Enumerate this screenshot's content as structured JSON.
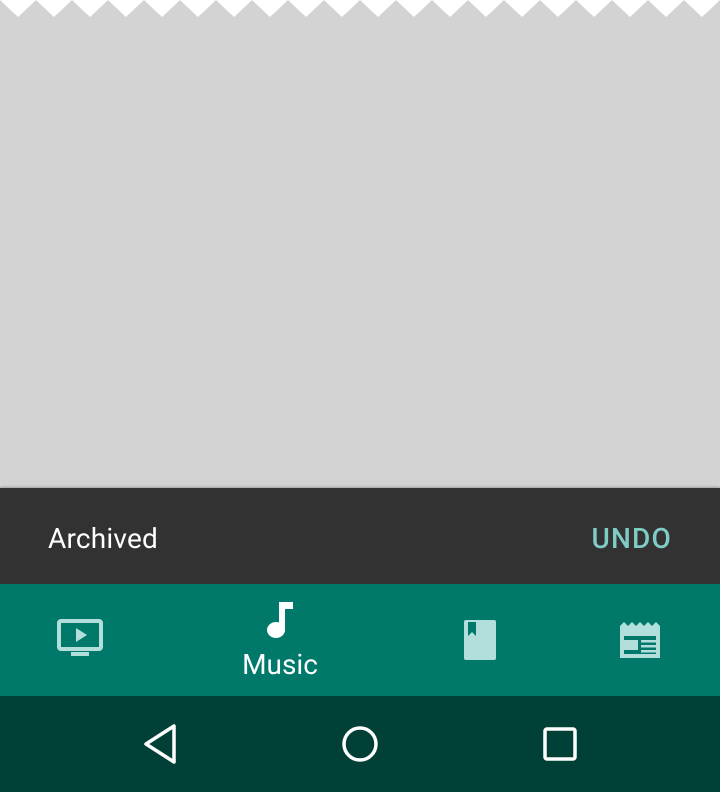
{
  "snackbar": {
    "message": "Archived",
    "action_label": "UNDO",
    "background": "#323232",
    "action_color": "#80cbc4"
  },
  "bottom_nav": {
    "background": "#00796b",
    "items": [
      {
        "icon": "tv-play-icon",
        "label": "",
        "active": false
      },
      {
        "icon": "music-note-icon",
        "label": "Music",
        "active": true
      },
      {
        "icon": "book-icon",
        "label": "",
        "active": false
      },
      {
        "icon": "newspaper-icon",
        "label": "",
        "active": false
      }
    ]
  },
  "system_nav": {
    "background": "#004036",
    "buttons": [
      "back-icon",
      "home-icon",
      "recents-icon"
    ]
  }
}
